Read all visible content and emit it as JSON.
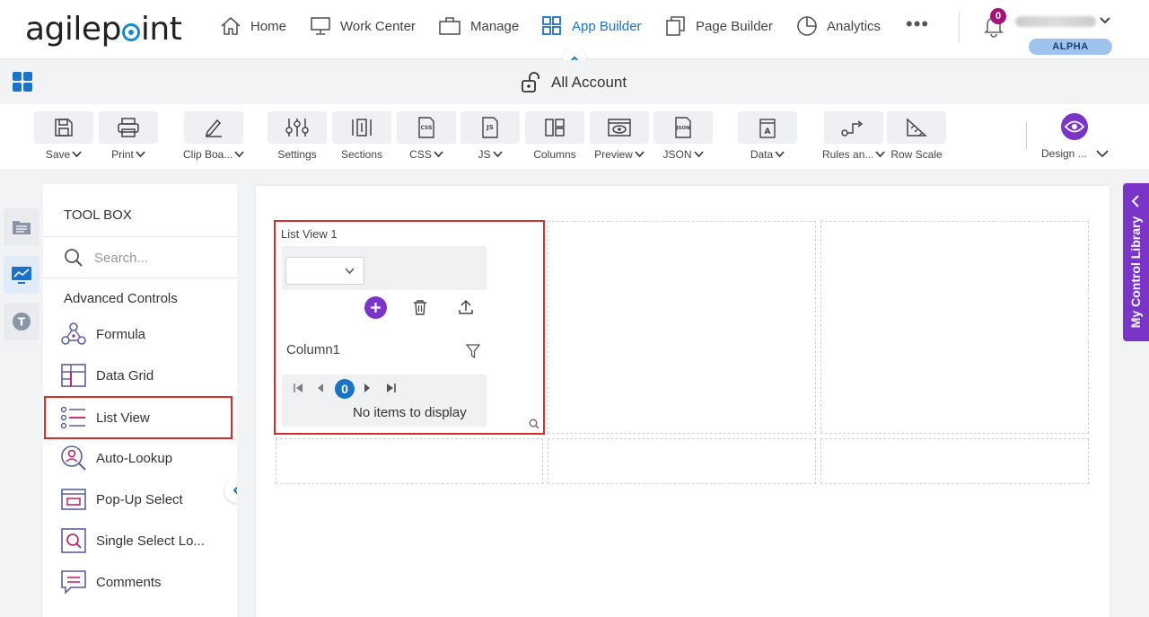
{
  "brand": {
    "logo_prefix": "agilep",
    "logo_suffix": "int",
    "accent": "#1a73c8",
    "purple": "#7b34c8"
  },
  "nav": {
    "items": [
      {
        "label": "Home",
        "icon": "home-icon"
      },
      {
        "label": "Work Center",
        "icon": "monitor-icon"
      },
      {
        "label": "Manage",
        "icon": "briefcase-icon"
      },
      {
        "label": "App Builder",
        "icon": "grid-icon",
        "active": true
      },
      {
        "label": "Page Builder",
        "icon": "pages-icon"
      },
      {
        "label": "Analytics",
        "icon": "pie-chart-icon"
      }
    ],
    "more": "•••",
    "notifications": "0",
    "tenant": "ALPHA"
  },
  "header": {
    "form_title": "All Account"
  },
  "toolbar": {
    "save": "Save",
    "print": "Print",
    "clipboard": "Clip Boa...",
    "settings": "Settings",
    "sections": "Sections",
    "css": "CSS",
    "js": "JS",
    "columns": "Columns",
    "preview": "Preview",
    "json": "JSON",
    "data": "Data",
    "rules": "Rules an...",
    "row_scale": "Row Scale",
    "design": "Design ..."
  },
  "toolbox": {
    "title": "TOOL BOX",
    "search_placeholder": "Search...",
    "category": "Advanced Controls",
    "controls": [
      "Formula",
      "Data Grid",
      "List View",
      "Auto-Lookup",
      "Pop-Up Select",
      "Single Select Lo...",
      "Comments"
    ]
  },
  "listview": {
    "title": "List View 1",
    "column": "Column1",
    "page": "0",
    "empty": "No items to display"
  },
  "library": {
    "label": "My Control Library"
  }
}
